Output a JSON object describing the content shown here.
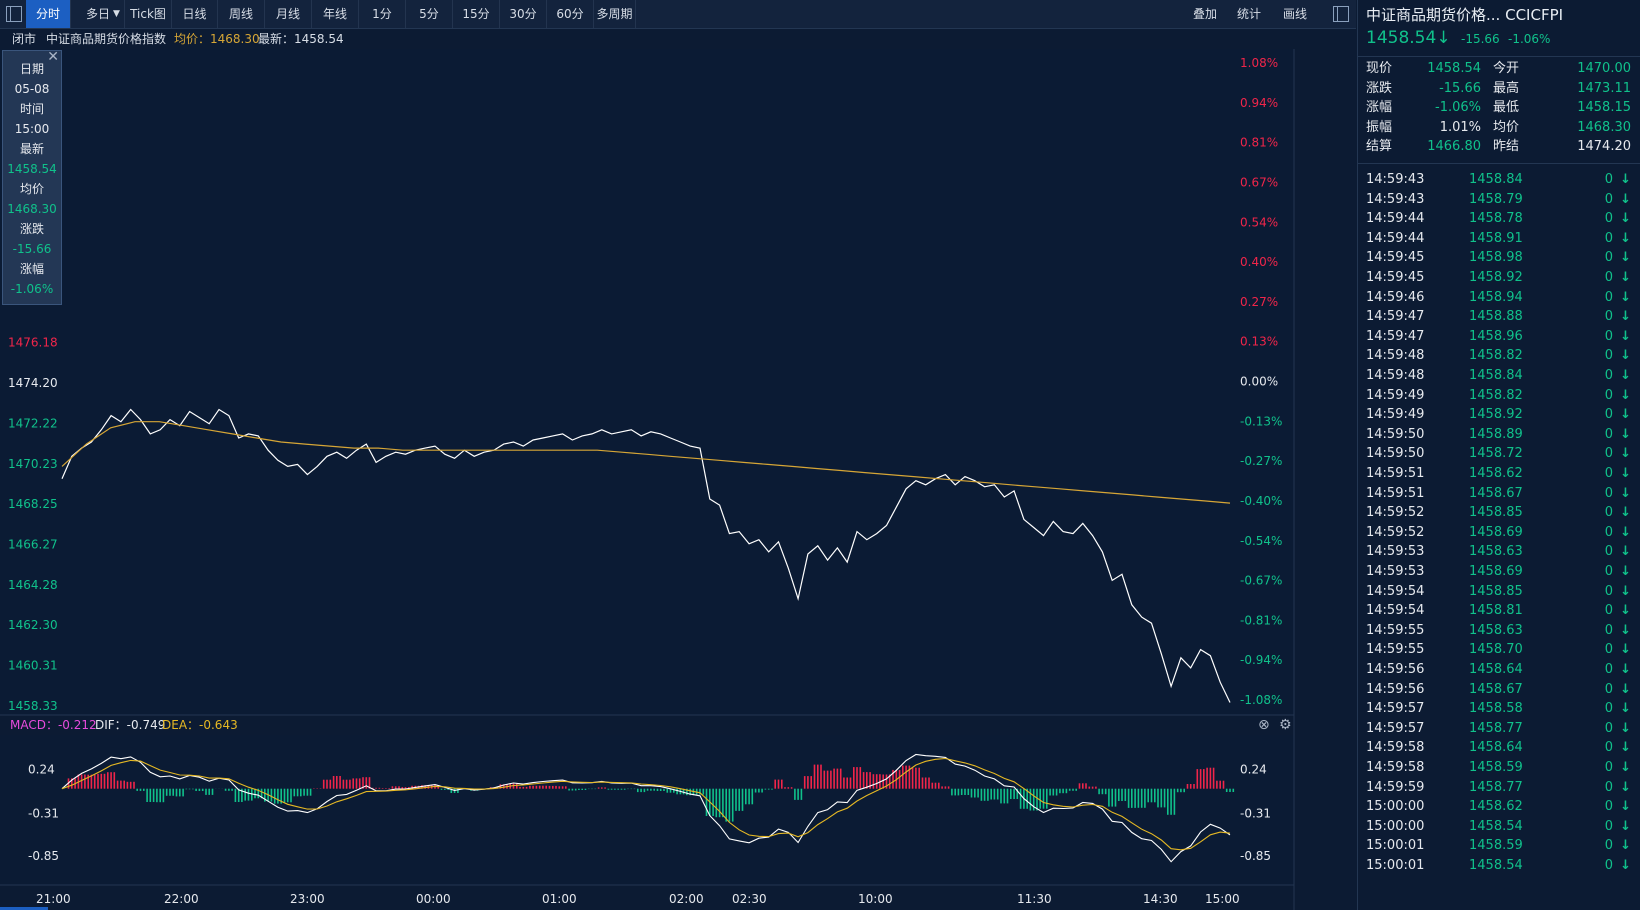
{
  "toolbar": {
    "tabs": [
      "分时",
      "多日",
      "Tick图",
      "日线",
      "周线",
      "月线",
      "年线",
      "1分",
      "5分",
      "15分",
      "30分",
      "60分",
      "多周期"
    ],
    "active_tab": "分时",
    "multi_day_arrow": "▼",
    "right_buttons": [
      "叠加",
      "统计",
      "画线"
    ]
  },
  "infobar": {
    "status": "闭市",
    "index_name": "中证商品期货价格指数",
    "avg_label": "均价：1468.30",
    "last_label": "最新：1458.54"
  },
  "tooltip": {
    "close": "✕",
    "rows": [
      {
        "label": "日期",
        "value": "05-08"
      },
      {
        "label": "时间",
        "value": "15:00"
      },
      {
        "label": "最新",
        "value": "1458.54"
      },
      {
        "label": "均价",
        "value": "1468.30"
      },
      {
        "label": "涨跌",
        "value": "-15.66"
      },
      {
        "label": "涨幅",
        "value": "-1.06%"
      }
    ]
  },
  "colors": {
    "up": "#f0254a",
    "down": "#10c18b",
    "neutral": "#e6e9ee",
    "price_line": "#ffffff",
    "avg_line": "#d6a636",
    "dea_color": "#e5b824",
    "macd_color": "#e64bdc"
  },
  "chart_data": [
    {
      "type": "line",
      "title": "中证商品期货价格指数",
      "y_ticks": [
        "1478.17",
        "1476.18",
        "1474.20",
        "1472.22",
        "1470.23",
        "1468.25",
        "1466.27",
        "1464.28",
        "1462.30",
        "1460.31",
        "1458.33"
      ],
      "y_ticks_visible_from": 1,
      "pct_ticks": [
        "1.08%",
        "0.94%",
        "0.81%",
        "0.67%",
        "0.54%",
        "0.40%",
        "0.27%",
        "0.13%",
        "0.00%",
        "-0.13%",
        "-0.27%",
        "-0.40%",
        "-0.54%",
        "-0.67%",
        "-0.81%",
        "-0.94%",
        "-1.08%"
      ],
      "pct_ticks_visible": [
        0,
        1,
        2,
        3,
        4,
        5,
        6,
        7,
        8,
        9,
        10,
        11,
        12,
        13,
        14,
        15,
        16
      ],
      "ylim": [
        1458.33,
        1490.07
      ],
      "prev_close": 1474.2,
      "x_ticks": [
        "21:00",
        "22:00",
        "23:00",
        "00:00",
        "01:00",
        "02:00",
        "02:30",
        "10:00",
        "11:30",
        "14:30",
        "15:00"
      ],
      "series": [
        {
          "values": [
            1469.5,
            1470.6,
            1471.0,
            1471.3,
            1471.9,
            1472.6,
            1472.3,
            1472.9,
            1472.4,
            1471.7,
            1471.9,
            1472.4,
            1472.1,
            1472.8,
            1472.5,
            1472.2,
            1472.9,
            1472.6,
            1471.5,
            1471.7,
            1471.6,
            1470.9,
            1470.4,
            1470.1,
            1470.2,
            1469.7,
            1470.1,
            1470.6,
            1470.8,
            1470.5,
            1470.9,
            1471.2,
            1470.3,
            1470.6,
            1470.8,
            1470.7,
            1470.9,
            1471.0,
            1471.1,
            1470.7,
            1470.5,
            1470.9,
            1470.6,
            1470.8,
            1470.9,
            1471.2,
            1471.3,
            1471.1,
            1471.4,
            1471.5,
            1471.6,
            1471.7,
            1471.4,
            1471.6,
            1471.7,
            1471.9,
            1471.7,
            1471.8,
            1471.9,
            1471.6,
            1471.8,
            1471.7,
            1471.5,
            1471.3,
            1471.1,
            1471.0,
            1468.5,
            1468.2,
            1466.8,
            1466.9,
            1466.3,
            1466.5,
            1465.9,
            1466.4,
            1465.1,
            1463.6,
            1465.8,
            1466.2,
            1465.5,
            1466.1,
            1465.4,
            1466.9,
            1466.5,
            1466.8,
            1467.2,
            1468.1,
            1469.0,
            1469.4,
            1469.2,
            1469.5,
            1469.7,
            1469.2,
            1469.6,
            1469.4,
            1469.1,
            1469.2,
            1468.6,
            1468.9,
            1467.5,
            1467.1,
            1466.7,
            1467.4,
            1466.9,
            1466.8,
            1467.3,
            1466.7,
            1465.9,
            1464.5,
            1464.8,
            1463.3,
            1462.7,
            1462.4,
            1460.9,
            1459.3,
            1460.7,
            1460.2,
            1461.1,
            1460.8,
            1459.5,
            1458.5
          ]
        },
        {
          "values": [
            1470.1,
            1471.2,
            1472.0,
            1472.3,
            1472.3,
            1472.1,
            1471.9,
            1471.7,
            1471.5,
            1471.3,
            1471.2,
            1471.1,
            1471.0,
            1471.0,
            1470.9,
            1470.9,
            1470.9,
            1470.9,
            1470.9,
            1470.9,
            1470.9,
            1470.9,
            1470.9,
            1470.8,
            1470.7,
            1470.6,
            1470.5,
            1470.4,
            1470.3,
            1470.2,
            1470.1,
            1470.0,
            1469.9,
            1469.8,
            1469.7,
            1469.6,
            1469.5,
            1469.4,
            1469.3,
            1469.2,
            1469.1,
            1469.0,
            1468.9,
            1468.8,
            1468.7,
            1468.6,
            1468.5,
            1468.4,
            1468.3
          ]
        }
      ]
    },
    {
      "type": "bar",
      "title": "MACD",
      "labels": {
        "macd": "MACD：-0.212",
        "dif": "DIF：-0.749",
        "dea": "DEA：-0.643"
      },
      "y_ticks": [
        "0.24",
        "-0.31",
        "-0.85"
      ],
      "ylim": [
        -1.15,
        0.55
      ]
    }
  ],
  "right_panel": {
    "title": "中证商品期货价格...",
    "code": "CCICFPI",
    "price": "1458.54",
    "price_arrow": "↓",
    "change": "-15.66",
    "change_pct": "-1.06%",
    "quotes": [
      {
        "l1": "现价",
        "v1": "1458.54",
        "c1": "down",
        "l2": "今开",
        "v2": "1470.00",
        "c2": "down"
      },
      {
        "l1": "涨跌",
        "v1": "-15.66",
        "c1": "down",
        "l2": "最高",
        "v2": "1473.11",
        "c2": "down"
      },
      {
        "l1": "涨幅",
        "v1": "-1.06%",
        "c1": "down",
        "l2": "最低",
        "v2": "1458.15",
        "c2": "down"
      },
      {
        "l1": "振幅",
        "v1": "1.01%",
        "c1": "neutral",
        "l2": "均价",
        "v2": "1468.30",
        "c2": "down"
      },
      {
        "l1": "结算",
        "v1": "1466.80",
        "c1": "down",
        "l2": "昨结",
        "v2": "1474.20",
        "c2": "neutral"
      }
    ],
    "ticks": [
      {
        "time": "14:59:43",
        "price": "1458.84",
        "vol": "0"
      },
      {
        "time": "14:59:43",
        "price": "1458.79",
        "vol": "0"
      },
      {
        "time": "14:59:44",
        "price": "1458.78",
        "vol": "0"
      },
      {
        "time": "14:59:44",
        "price": "1458.91",
        "vol": "0"
      },
      {
        "time": "14:59:45",
        "price": "1458.98",
        "vol": "0"
      },
      {
        "time": "14:59:45",
        "price": "1458.92",
        "vol": "0"
      },
      {
        "time": "14:59:46",
        "price": "1458.94",
        "vol": "0"
      },
      {
        "time": "14:59:47",
        "price": "1458.88",
        "vol": "0"
      },
      {
        "time": "14:59:47",
        "price": "1458.96",
        "vol": "0"
      },
      {
        "time": "14:59:48",
        "price": "1458.82",
        "vol": "0"
      },
      {
        "time": "14:59:48",
        "price": "1458.84",
        "vol": "0"
      },
      {
        "time": "14:59:49",
        "price": "1458.82",
        "vol": "0"
      },
      {
        "time": "14:59:49",
        "price": "1458.92",
        "vol": "0"
      },
      {
        "time": "14:59:50",
        "price": "1458.89",
        "vol": "0"
      },
      {
        "time": "14:59:50",
        "price": "1458.72",
        "vol": "0"
      },
      {
        "time": "14:59:51",
        "price": "1458.62",
        "vol": "0"
      },
      {
        "time": "14:59:51",
        "price": "1458.67",
        "vol": "0"
      },
      {
        "time": "14:59:52",
        "price": "1458.85",
        "vol": "0"
      },
      {
        "time": "14:59:52",
        "price": "1458.69",
        "vol": "0"
      },
      {
        "time": "14:59:53",
        "price": "1458.63",
        "vol": "0"
      },
      {
        "time": "14:59:53",
        "price": "1458.69",
        "vol": "0"
      },
      {
        "time": "14:59:54",
        "price": "1458.85",
        "vol": "0"
      },
      {
        "time": "14:59:54",
        "price": "1458.81",
        "vol": "0"
      },
      {
        "time": "14:59:55",
        "price": "1458.63",
        "vol": "0"
      },
      {
        "time": "14:59:55",
        "price": "1458.70",
        "vol": "0"
      },
      {
        "time": "14:59:56",
        "price": "1458.64",
        "vol": "0"
      },
      {
        "time": "14:59:56",
        "price": "1458.67",
        "vol": "0"
      },
      {
        "time": "14:59:57",
        "price": "1458.58",
        "vol": "0"
      },
      {
        "time": "14:59:57",
        "price": "1458.77",
        "vol": "0"
      },
      {
        "time": "14:59:58",
        "price": "1458.64",
        "vol": "0"
      },
      {
        "time": "14:59:58",
        "price": "1458.59",
        "vol": "0"
      },
      {
        "time": "14:59:59",
        "price": "1458.77",
        "vol": "0"
      },
      {
        "time": "15:00:00",
        "price": "1458.62",
        "vol": "0"
      },
      {
        "time": "15:00:00",
        "price": "1458.54",
        "vol": "0"
      },
      {
        "time": "15:00:01",
        "price": "1458.59",
        "vol": "0"
      },
      {
        "time": "15:00:01",
        "price": "1458.54",
        "vol": "0"
      }
    ],
    "tick_arrow": "🡇"
  }
}
